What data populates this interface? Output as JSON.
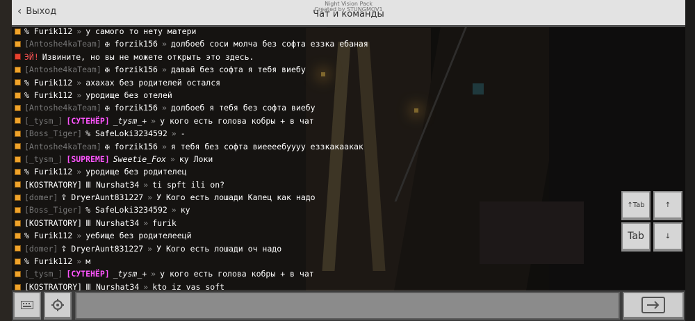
{
  "header": {
    "back_label": "Выход",
    "title": "Чат и команды",
    "overlay_line1": "Night Vision Pack",
    "overlay_line2": "Created by STUNGMOV1"
  },
  "chat": [
    {
      "icon": "orange",
      "parts": [
        {
          "t": "% Furik112",
          "c": ""
        },
        {
          "t": "»",
          "c": "arrow"
        },
        {
          "t": "у самого то нету матери",
          "c": ""
        }
      ]
    },
    {
      "icon": "orange",
      "parts": [
        {
          "t": "[Antoshe4kaTeam]",
          "c": "dim sp"
        },
        {
          "t": "✠ forzik156",
          "c": ""
        },
        {
          "t": "»",
          "c": "arrow"
        },
        {
          "t": "долбоеб соси молча без софта еззка ебаная",
          "c": ""
        }
      ]
    },
    {
      "icon": "red",
      "parts": [
        {
          "t": "ЭЙ!",
          "c": "red sp"
        },
        {
          "t": "Извините, но вы не можете открыть это здесь.",
          "c": ""
        }
      ]
    },
    {
      "icon": "orange",
      "parts": [
        {
          "t": "[Antoshe4kaTeam]",
          "c": "dim sp"
        },
        {
          "t": "✠ forzik156",
          "c": ""
        },
        {
          "t": "»",
          "c": "arrow"
        },
        {
          "t": "давай без софта я тебя виебу",
          "c": ""
        }
      ]
    },
    {
      "icon": "orange",
      "parts": [
        {
          "t": "% Furik112",
          "c": ""
        },
        {
          "t": "»",
          "c": "arrow"
        },
        {
          "t": "ахахах без родителей остался",
          "c": ""
        }
      ]
    },
    {
      "icon": "orange",
      "parts": [
        {
          "t": "% Furik112",
          "c": ""
        },
        {
          "t": "»",
          "c": "arrow"
        },
        {
          "t": "уродище без отелей",
          "c": ""
        }
      ]
    },
    {
      "icon": "orange",
      "parts": [
        {
          "t": "[Antoshe4kaTeam]",
          "c": "dim sp"
        },
        {
          "t": "✠ forzik156",
          "c": ""
        },
        {
          "t": "»",
          "c": "arrow"
        },
        {
          "t": "долбоеб я тебя без софта виебу",
          "c": ""
        }
      ]
    },
    {
      "icon": "orange",
      "parts": [
        {
          "t": "[_tysm_]",
          "c": "dim sp"
        },
        {
          "t": "[СУТЕНЁР]",
          "c": "mag sp"
        },
        {
          "t": "_tysm_+",
          "c": "ital"
        },
        {
          "t": "»",
          "c": "arrow"
        },
        {
          "t": "у кого есть голова кобры + в чат",
          "c": ""
        }
      ]
    },
    {
      "icon": "orange",
      "parts": [
        {
          "t": "[Boss_Tiger]",
          "c": "dim sp"
        },
        {
          "t": "% SafeLoki3234592",
          "c": ""
        },
        {
          "t": "»",
          "c": "arrow"
        },
        {
          "t": "-",
          "c": ""
        }
      ]
    },
    {
      "icon": "orange",
      "parts": [
        {
          "t": "[Antoshe4kaTeam]",
          "c": "dim sp"
        },
        {
          "t": "✠ forzik156",
          "c": ""
        },
        {
          "t": "»",
          "c": "arrow"
        },
        {
          "t": "я тебя без софта виеееебуууу еззкакаакак",
          "c": ""
        }
      ]
    },
    {
      "icon": "orange",
      "parts": [
        {
          "t": "[_tysm_]",
          "c": "dim sp"
        },
        {
          "t": "[SUPREME]",
          "c": "mag sp"
        },
        {
          "t": "Sweetie_Fox",
          "c": "ital"
        },
        {
          "t": "»",
          "c": "arrow"
        },
        {
          "t": "ку Локи",
          "c": ""
        }
      ]
    },
    {
      "icon": "orange",
      "parts": [
        {
          "t": "% Furik112",
          "c": ""
        },
        {
          "t": "»",
          "c": "arrow"
        },
        {
          "t": "уродище без родителец",
          "c": ""
        }
      ]
    },
    {
      "icon": "orange",
      "parts": [
        {
          "t": "[KOSTRATORY]",
          "c": "sp"
        },
        {
          "t": "Ⅲ Nurshat34",
          "c": ""
        },
        {
          "t": "»",
          "c": "arrow"
        },
        {
          "t": "ti spft ili on?",
          "c": ""
        }
      ]
    },
    {
      "icon": "orange",
      "parts": [
        {
          "t": "[domer]",
          "c": "dim sp"
        },
        {
          "t": "☦ DryerAunt831227",
          "c": ""
        },
        {
          "t": "»",
          "c": "arrow"
        },
        {
          "t": "У Кого есть лошади Капец как надо",
          "c": ""
        }
      ]
    },
    {
      "icon": "orange",
      "parts": [
        {
          "t": "[Boss_Tiger]",
          "c": "dim sp"
        },
        {
          "t": "% SafeLoki3234592",
          "c": ""
        },
        {
          "t": "»",
          "c": "arrow"
        },
        {
          "t": "ку",
          "c": ""
        }
      ]
    },
    {
      "icon": "orange",
      "parts": [
        {
          "t": "[KOSTRATORY]",
          "c": "sp"
        },
        {
          "t": "Ⅲ Nurshat34",
          "c": ""
        },
        {
          "t": "»",
          "c": "arrow"
        },
        {
          "t": "furik",
          "c": ""
        }
      ]
    },
    {
      "icon": "orange",
      "parts": [
        {
          "t": "% Furik112",
          "c": ""
        },
        {
          "t": "»",
          "c": "arrow"
        },
        {
          "t": "уебище без родителеецй",
          "c": ""
        }
      ]
    },
    {
      "icon": "orange",
      "parts": [
        {
          "t": "[domer]",
          "c": "dim sp"
        },
        {
          "t": "☦ DryerAunt831227",
          "c": ""
        },
        {
          "t": "»",
          "c": "arrow"
        },
        {
          "t": "У Кого есть лошади оч надо",
          "c": ""
        }
      ]
    },
    {
      "icon": "orange",
      "parts": [
        {
          "t": "% Furik112",
          "c": ""
        },
        {
          "t": "»",
          "c": "arrow"
        },
        {
          "t": "м",
          "c": ""
        }
      ]
    },
    {
      "icon": "orange",
      "parts": [
        {
          "t": "[_tysm_]",
          "c": "dim sp"
        },
        {
          "t": "[СУТЕНЁР]",
          "c": "mag sp"
        },
        {
          "t": "_tysm_+",
          "c": "ital"
        },
        {
          "t": "»",
          "c": "arrow"
        },
        {
          "t": "у кого есть голова кобры + в чат",
          "c": ""
        }
      ]
    },
    {
      "icon": "orange",
      "parts": [
        {
          "t": "[KOSTRATORY]",
          "c": "sp"
        },
        {
          "t": "Ⅲ Nurshat34",
          "c": ""
        },
        {
          "t": "»",
          "c": "arrow"
        },
        {
          "t": "kto iz vas soft",
          "c": ""
        }
      ]
    }
  ],
  "keys": {
    "tab_up": "↑Tab",
    "arrow_up": "↑",
    "tab": "Tab",
    "arrow_down": "↓"
  },
  "input": {
    "value": "",
    "placeholder": ""
  },
  "icons": {
    "back": "chevron-left-icon",
    "keyboard": "keyboard-icon",
    "settings": "gear-icon",
    "send": "send-arrow-icon"
  },
  "colors": {
    "rank_magenta": "#ff55ff",
    "warning_red": "#ff5555",
    "topbar": "#e3e3e3"
  }
}
